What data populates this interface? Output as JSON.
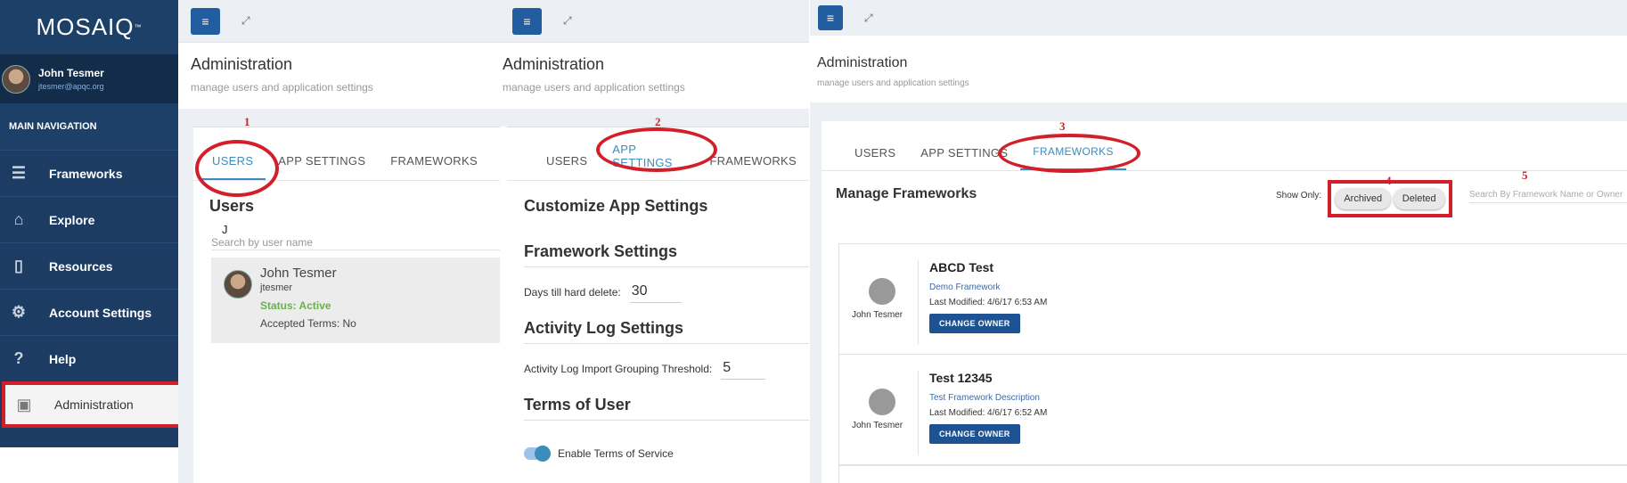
{
  "brand": {
    "name": "MOSAIQ",
    "tm": "™"
  },
  "user": {
    "name": "John Tesmer",
    "email": "jtesmer@apqc.org"
  },
  "nav": {
    "header": "MAIN NAVIGATION",
    "items": [
      {
        "label": "Frameworks",
        "icon": "frameworks-icon"
      },
      {
        "label": "Explore",
        "icon": "explore-icon"
      },
      {
        "label": "Resources",
        "icon": "resources-icon"
      },
      {
        "label": "Account Settings",
        "icon": "gear-icon"
      },
      {
        "label": "Help",
        "icon": "help-icon"
      },
      {
        "label": "Administration",
        "icon": "admin-icon"
      }
    ]
  },
  "page": {
    "title": "Administration",
    "subtitle": "manage users and application settings"
  },
  "tabs": {
    "users": "USERS",
    "app_settings": "APP SETTINGS",
    "frameworks": "FRAMEWORKS"
  },
  "annotations": [
    "1",
    "2",
    "3",
    "4",
    "5"
  ],
  "users_panel": {
    "heading": "Users",
    "search_value": "J",
    "search_placeholder": "Search by user name",
    "result": {
      "name": "John Tesmer",
      "username": "jtesmer",
      "status": "Status: Active",
      "terms": "Accepted Terms: No"
    }
  },
  "app_settings_panel": {
    "heading": "Customize App Settings",
    "framework_heading": "Framework Settings",
    "days_label": "Days till hard delete:",
    "days_value": "30",
    "activity_heading": "Activity Log Settings",
    "threshold_label": "Activity Log Import Grouping Threshold:",
    "threshold_value": "5",
    "terms_heading": "Terms of User",
    "terms_toggle_label": "Enable Terms of Service"
  },
  "frameworks_panel": {
    "heading": "Manage Frameworks",
    "show_only": "Show Only:",
    "filters": [
      "Archived",
      "Deleted"
    ],
    "search_placeholder": "Search By Framework Name or Owner",
    "change_owner": "CHANGE OWNER",
    "items": [
      {
        "owner": "John Tesmer",
        "title": "ABCD Test",
        "description": "Demo Framework",
        "modified": "Last Modified: 4/6/17 6:53 AM"
      },
      {
        "owner": "John Tesmer",
        "title": "Test 12345",
        "description": "Test Framework Description",
        "modified": "Last Modified: 4/6/17 6:52 AM"
      }
    ]
  },
  "colors": {
    "sidebar": "#1c3c63",
    "accent": "#3c8dbc",
    "annotation": "#d31f2a",
    "button": "#1d5393"
  }
}
